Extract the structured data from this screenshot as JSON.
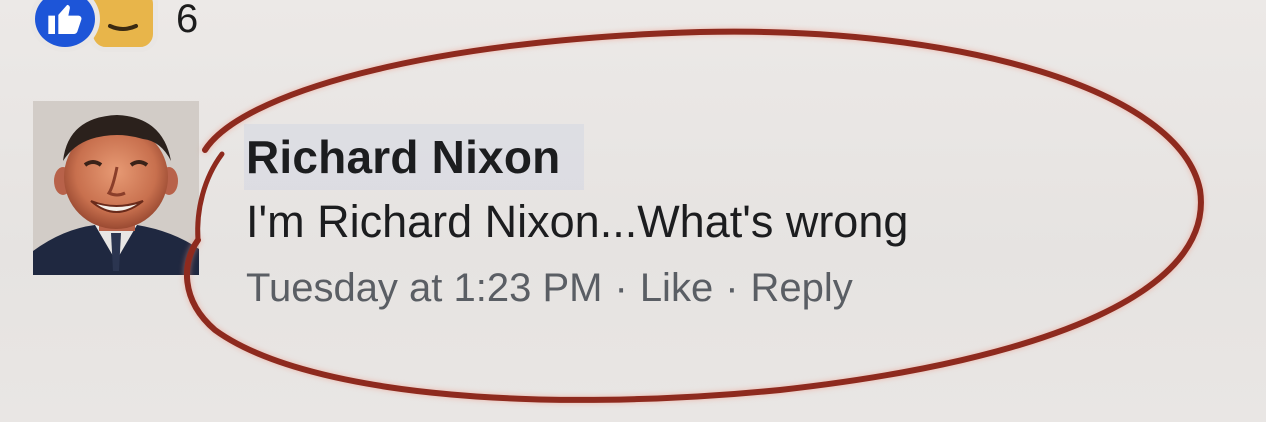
{
  "reactions": {
    "icons": [
      "like-icon",
      "haha-icon"
    ],
    "count": "6"
  },
  "comment": {
    "author": "Richard Nixon",
    "text": "I'm Richard Nixon...What's wrong",
    "timestamp": "Tuesday at 1:23 PM",
    "separator": "·",
    "like_label": "Like",
    "reply_label": "Reply"
  },
  "colors": {
    "like_blue": "#1d55d8",
    "haha_yellow": "#e8b54a",
    "annotation_red": "#8e2a1e",
    "background": "#e9e6e4"
  }
}
